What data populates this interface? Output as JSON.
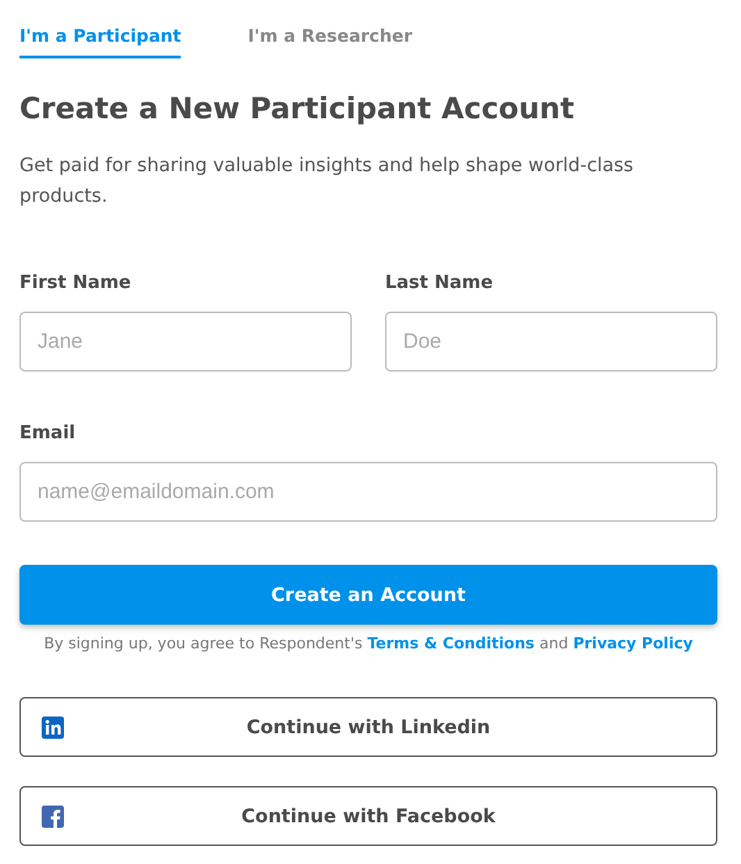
{
  "tabs": [
    {
      "label": "I'm a Participant",
      "selected": true
    },
    {
      "label": "I'm a Researcher",
      "selected": false
    }
  ],
  "title": "Create a New Participant Account",
  "description": "Get paid for sharing valuable insights and help shape world-class products.",
  "name_fields": [
    {
      "label": "First Name",
      "placeholder": "Jane"
    },
    {
      "label": "Last Name",
      "placeholder": "Doe"
    }
  ],
  "email_field": {
    "label": "Email",
    "placeholder": "name@emaildomain.com"
  },
  "submit_button": "Create an Account",
  "terms": {
    "text": "By signing up, you agree to Respondent's",
    "link_1": "Terms & Conditions",
    "joiner": "and",
    "link_2": "Privacy Policy"
  },
  "social_buttons": [
    {
      "kind": "linkedin",
      "label": "Continue with Linkedin"
    },
    {
      "kind": "facebook",
      "label": "Continue with Facebook"
    }
  ]
}
